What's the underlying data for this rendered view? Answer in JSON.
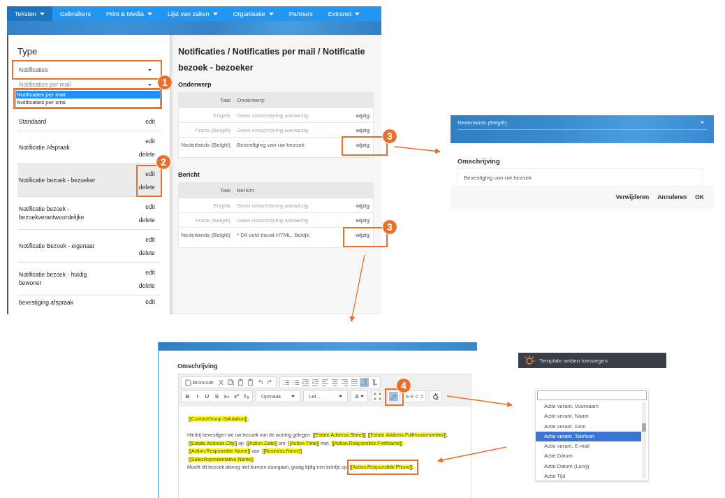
{
  "main_screen": {
    "nav": [
      {
        "label": "Teksten",
        "dropdown": true,
        "selected": true
      },
      {
        "label": "Gebruikers",
        "dropdown": false,
        "selected": false
      },
      {
        "label": "Print & Media",
        "dropdown": true,
        "selected": false
      },
      {
        "label": "Lijst van zaken",
        "dropdown": true,
        "selected": false
      },
      {
        "label": "Organisatie",
        "dropdown": true,
        "selected": false
      },
      {
        "label": "Partners",
        "dropdown": false,
        "selected": false
      },
      {
        "label": "Extranet",
        "dropdown": true,
        "selected": false
      }
    ],
    "sidebar": {
      "title": "Type",
      "type_select": "Notificaties",
      "subtype_select": "Notificaties per mail",
      "subtype_options": [
        {
          "label": "Notificaties per mail",
          "selected": true
        },
        {
          "label": "Notificaties per sms",
          "selected": false
        }
      ],
      "items": [
        {
          "name": "Standaard",
          "actions": [
            "edit"
          ],
          "selected": false
        },
        {
          "name": "Notificatie Afspraak",
          "actions": [
            "edit",
            "delete"
          ],
          "selected": false
        },
        {
          "name": "Notificatie bezoek - bezoeker",
          "actions": [
            "edit",
            "delete"
          ],
          "selected": true
        },
        {
          "name": "Notificatie bezoek - bezoekverantwoordelijke",
          "actions": [
            "edit",
            "delete"
          ],
          "selected": false
        },
        {
          "name": "Notificatie Bezoek - eigenaar",
          "actions": [
            "edit",
            "delete"
          ],
          "selected": false
        },
        {
          "name": "Notificatie bezoek - huidig bewoner",
          "actions": [
            "edit",
            "delete"
          ],
          "selected": false
        },
        {
          "name": "bevestiging afspraak",
          "actions": [
            "edit"
          ],
          "selected": false
        }
      ]
    },
    "content": {
      "breadcrumb": "Notificaties / Notificaties per mail / Notificatie bezoek - bezoeker",
      "sections": [
        {
          "title": "Onderwerp",
          "columns": [
            "Taal",
            "Onderwerp"
          ],
          "rows": [
            {
              "language": "Engels",
              "text": "Geen omschrijving aanwezig",
              "action": "wijzig",
              "filled": false
            },
            {
              "language": "Frans (België)",
              "text": "Geen omschrijving aanwezig",
              "action": "wijzig",
              "filled": false
            },
            {
              "language": "Nederlands (België)",
              "text": "Bevestiging van uw bezoek",
              "action": "wijzig",
              "filled": true
            }
          ]
        },
        {
          "title": "Bericht",
          "columns": [
            "Taal",
            "Bericht"
          ],
          "rows": [
            {
              "language": "Engels",
              "text": "Geen omschrijving aanwezig",
              "action": "wijzig",
              "filled": false
            },
            {
              "language": "Frans (België)",
              "text": "Geen omschrijving aanwezig",
              "action": "wijzig",
              "filled": false
            },
            {
              "language": "Nederlands (België)",
              "text": "* Dit veld bevat HTML. Bekijk.",
              "action": "wijzig",
              "filled": true
            }
          ]
        }
      ]
    }
  },
  "dialog_screen": {
    "language_select": "Nederlands (België)",
    "field_label": "Omschrijving",
    "field_value": "Bevestiging van uw bezoek",
    "buttons": [
      "Verwijderen",
      "Annuleren",
      "OK"
    ]
  },
  "editor_screen": {
    "field_label": "Omschrijving",
    "toolbar_rows": [
      [
        {
          "items": [
            {
              "kind": "source",
              "label": "Broncode"
            },
            {
              "kind": "cut"
            },
            {
              "kind": "copy"
            },
            {
              "kind": "paste"
            },
            {
              "kind": "paste"
            },
            {
              "kind": "undo"
            },
            {
              "kind": "redo"
            }
          ]
        },
        {
          "items": [
            {
              "kind": "numbered-list"
            },
            {
              "kind": "bullet-list"
            },
            {
              "kind": "outdent"
            },
            {
              "kind": "indent"
            },
            {
              "kind": "align-left",
              "active": false
            },
            {
              "kind": "align-center",
              "active": false
            },
            {
              "kind": "align-right",
              "active": false
            },
            {
              "kind": "justify",
              "active": false
            },
            {
              "kind": "ltr",
              "active": true
            },
            {
              "kind": "rtl",
              "active": false
            }
          ]
        }
      ],
      [
        {
          "items": [
            {
              "kind": "glyph",
              "text": "B"
            },
            {
              "kind": "glyph",
              "text": "I"
            },
            {
              "kind": "glyph",
              "text": "U"
            },
            {
              "kind": "glyph",
              "text": "S"
            },
            {
              "kind": "glyph",
              "text": "x₂"
            },
            {
              "kind": "glyph",
              "text": "x²"
            },
            {
              "kind": "glyph",
              "text": "Tₓ"
            }
          ]
        },
        {
          "items": [
            {
              "kind": "dropdown",
              "label": "Opmaak"
            }
          ]
        },
        {
          "items": [
            {
              "kind": "dropdown",
              "label": "Let..."
            }
          ]
        },
        {
          "items": [
            {
              "kind": "color",
              "text": "A"
            }
          ]
        },
        {
          "items": [
            {
              "kind": "maximize"
            }
          ]
        },
        {
          "items": [
            {
              "kind": "highlight",
              "active": true
            }
          ]
        },
        {
          "items": [
            {
              "kind": "link"
            },
            {
              "kind": "unlink"
            }
          ]
        },
        {
          "items": [
            {
              "kind": "template-fields"
            }
          ]
        }
      ]
    ],
    "lines": [
      {
        "space_before": false,
        "segments": [
          {
            "text": "[[ContactGroup.Salutation]]",
            "field": true
          },
          {
            "text": ",",
            "field": false
          }
        ]
      },
      {
        "space_before": true,
        "segments": [
          {
            "text": "Hierbij bevestigen we uw bezoek van de woning gelegen ",
            "field": false
          },
          {
            "text": "[[Estate.Address.Street]]",
            "field": true
          },
          {
            "text": "[[Estate.Address.FullHousenumber]]",
            "field": true
          },
          {
            "text": ",",
            "field": false
          }
        ]
      },
      {
        "space_before": false,
        "segments": [
          {
            "text": "[[Estate.Address.City]]",
            "field": true
          },
          {
            "text": " op ",
            "field": false
          },
          {
            "text": "[[Action.Date]]",
            "field": true
          },
          {
            "text": " om ",
            "field": false
          },
          {
            "text": "[[Action.Time]]",
            "field": true
          },
          {
            "text": " met ",
            "field": false
          },
          {
            "text": "[[Action.Responsible.FirstName]]",
            "field": true
          }
        ]
      },
      {
        "space_before": false,
        "segments": [
          {
            "text": "[[Action.Responsible.Name]]",
            "field": true
          },
          {
            "text": " van ",
            "field": false
          },
          {
            "text": "[[Business.Name]]",
            "field": true
          },
          {
            "text": ".",
            "field": false
          }
        ]
      },
      {
        "space_before": false,
        "segments": [
          {
            "text": "[[SalesRepresentative.Name]]",
            "field": true
          }
        ]
      },
      {
        "space_before": false,
        "segments": [
          {
            "text": "Mocht dit bezoek alsnog niet kunnen doorgaan, graag tijdig een seintje op ",
            "field": false
          },
          {
            "text": "[[Action.Responsible.Phone]]",
            "field": true
          },
          {
            "text": ".",
            "field": false
          }
        ]
      }
    ]
  },
  "field_picker": {
    "title": "Template velden toevoegen",
    "options": [
      {
        "label": "Actie verant. Voornaam",
        "selected": false
      },
      {
        "label": "Actie verant. Naam",
        "selected": false
      },
      {
        "label": "Actie verant. Gsm",
        "selected": false
      },
      {
        "label": "Actie verant. Telefoon",
        "selected": true
      },
      {
        "label": "Actie verant. E-mail",
        "selected": false
      },
      {
        "label": "Actie Datum",
        "selected": false
      },
      {
        "label": "Actie Datum (Lang)",
        "selected": false
      },
      {
        "label": "Actie Tijd",
        "selected": false
      }
    ]
  },
  "callouts": [
    {
      "number": "1"
    },
    {
      "number": "2"
    },
    {
      "number": "3"
    },
    {
      "number": "3"
    },
    {
      "number": "4"
    }
  ]
}
